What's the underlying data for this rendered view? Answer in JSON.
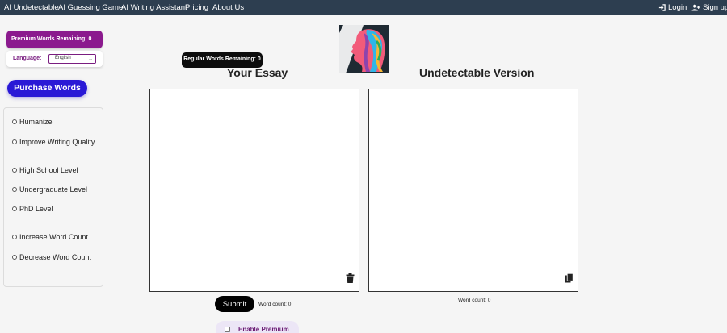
{
  "nav": {
    "items": [
      "AI Undetectable",
      "AI Guessing Game",
      "AI Writing Assistant",
      "Pricing",
      "About Us"
    ],
    "login_label": "Login",
    "signup_label": "Sign up",
    "background": "#2d3e50"
  },
  "sidebar": {
    "premium_words": "Premium Words Remaining: 0",
    "language_label": "Language:",
    "language_value": "English",
    "purchase_label": "Purchase Words",
    "options": [
      "Humanize",
      "Improve Writing Quality",
      "High School Level",
      "Undergraduate Level",
      "PhD Level",
      "Increase Word Count",
      "Decrease Word Count"
    ]
  },
  "main": {
    "regular_words": "Regular Words Remaining: 0",
    "essay_heading": "Your Essay",
    "output_heading": "Undetectable Version",
    "submit_label": "Submit",
    "input_word_count": "Word count: 0",
    "output_word_count": "Word count: 0",
    "premium_toggle_label": "Enable Premium"
  },
  "colors": {
    "purchase": "#2a19d6",
    "premium": "#8b1a8e"
  },
  "icons": {
    "login": "login-icon",
    "signup": "add-user-icon",
    "trash": "trash-icon",
    "copy": "copy-icon",
    "logo": "colorful-head-logo"
  }
}
